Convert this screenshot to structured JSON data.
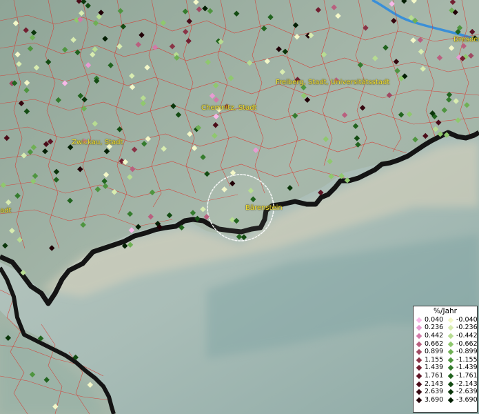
{
  "places": [
    {
      "id": "dresden",
      "name": "Dresden"
    },
    {
      "id": "freiberg",
      "name": "Freiberg, Stadt, Universitätsstadt"
    },
    {
      "id": "chemnitz",
      "name": "Chemnitz, Stadt"
    },
    {
      "id": "zwickau",
      "name": "Zwickau, Stadt"
    },
    {
      "id": "baerenstein",
      "name": "Bärenstein"
    },
    {
      "id": "stadt-left",
      "name": "adt"
    }
  ],
  "legend": {
    "title": "%/Jahr",
    "positive": [
      {
        "value": "0.040",
        "color": "#f7b8e8"
      },
      {
        "value": "0.236",
        "color": "#e79bd2"
      },
      {
        "value": "0.442",
        "color": "#d27aa8"
      },
      {
        "value": "0.662",
        "color": "#b9607f"
      },
      {
        "value": "0.899",
        "color": "#a04a63"
      },
      {
        "value": "1.155",
        "color": "#8a3447"
      },
      {
        "value": "1.439",
        "color": "#721f31"
      },
      {
        "value": "1.761",
        "color": "#5e1424"
      },
      {
        "value": "2.143",
        "color": "#4a0b18"
      },
      {
        "value": "2.639",
        "color": "#35060f"
      },
      {
        "value": "3.690",
        "color": "#200006"
      }
    ],
    "negative": [
      {
        "value": "-0.040",
        "color": "#f3f7c8"
      },
      {
        "value": "-0.236",
        "color": "#d8ecb0"
      },
      {
        "value": "-0.442",
        "color": "#b7dc92"
      },
      {
        "value": "-0.662",
        "color": "#8fc86e"
      },
      {
        "value": "-0.899",
        "color": "#6fb054"
      },
      {
        "value": "-1.155",
        "color": "#4f9540"
      },
      {
        "value": "-1.439",
        "color": "#357c2e"
      },
      {
        "value": "-1.761",
        "color": "#22641f"
      },
      {
        "value": "-2.143",
        "color": "#144c13"
      },
      {
        "value": "-2.639",
        "color": "#0b360b"
      },
      {
        "value": "-3.690",
        "color": "#041f04"
      }
    ]
  },
  "colors": {
    "border_lines": "#d9342b",
    "national_border": "#141414",
    "river": "#3a8fd8",
    "label": "#f2e23a",
    "highlight_circle": "#ffffff"
  }
}
